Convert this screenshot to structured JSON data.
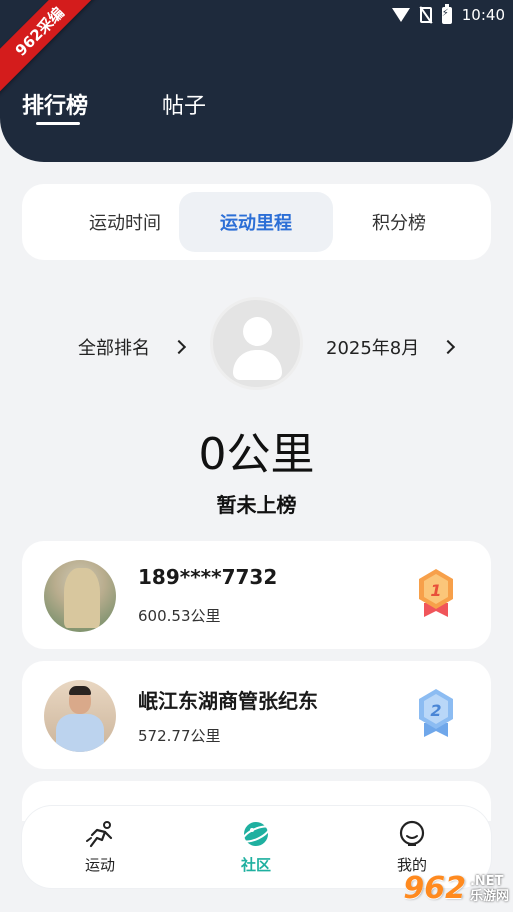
{
  "ribbon": "962采编",
  "status": {
    "time": "10:40"
  },
  "top_tabs": [
    {
      "label": "排行榜",
      "active": true
    },
    {
      "label": "帖子",
      "active": false
    }
  ],
  "segments": [
    {
      "label": "运动时间",
      "active": false
    },
    {
      "label": "运动里程",
      "active": true
    },
    {
      "label": "积分榜",
      "active": false
    }
  ],
  "summary": {
    "scope": "全部排名",
    "month": "2025年8月",
    "distance": "0公里",
    "status": "暂未上榜"
  },
  "leaderboard": [
    {
      "rank": "1",
      "name": "189****7732",
      "distance": "600.53公里",
      "medal_color": "#f2683a"
    },
    {
      "rank": "2",
      "name": "岷江东湖商管张纪东",
      "distance": "572.77公里",
      "medal_color": "#5d9be6"
    }
  ],
  "tabbar": [
    {
      "label": "运动",
      "icon": "running-icon",
      "active": false
    },
    {
      "label": "社区",
      "icon": "planet-icon",
      "active": true
    },
    {
      "label": "我的",
      "icon": "profile-face-icon",
      "active": false
    }
  ],
  "watermark": {
    "logo": "962",
    "domain": ".NET",
    "site": "乐游网"
  }
}
